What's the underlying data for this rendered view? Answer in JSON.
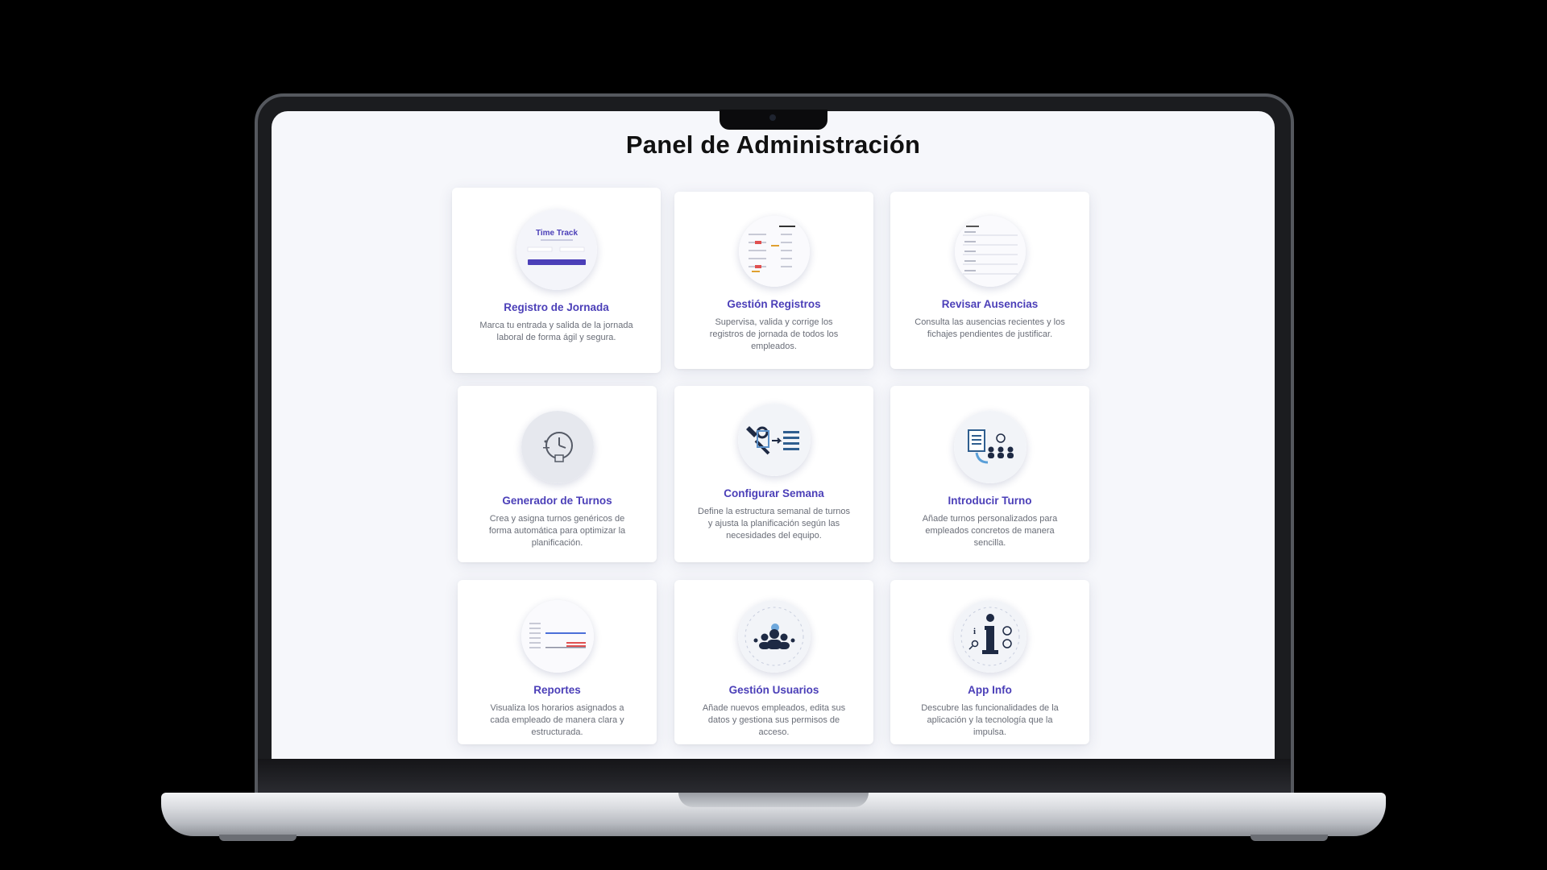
{
  "page": {
    "title": "Panel de Administración"
  },
  "colors": {
    "accent": "#4b3fb8",
    "background": "#f6f7fb",
    "card": "#ffffff",
    "description": "#6a6e78"
  },
  "cards": [
    {
      "title": "Registro de Jornada",
      "description": "Marca tu entrada y salida de la jornada laboral de forma ágil y segura.",
      "icon": "time-track-login-thumbnail",
      "thumb_title": "Time Track"
    },
    {
      "title": "Gestión Registros",
      "description": "Supervisa, valida y corrige los registros de jornada de todos los empleados.",
      "icon": "records-list-thumbnail"
    },
    {
      "title": "Revisar Ausencias",
      "description": "Consulta las ausencias recientes y los fichajes pendientes de justificar.",
      "icon": "absences-list-thumbnail"
    },
    {
      "title": "Generador de Turnos",
      "description": "Crea y asigna turnos genéricos de forma automática para optimizar la planificación.",
      "icon": "clock-calendar-icon"
    },
    {
      "title": "Configurar Semana",
      "description": "Define la estructura semanal de turnos y ajusta la planificación según las necesidades del equipo.",
      "icon": "tools-checklist-icon"
    },
    {
      "title": "Introducir Turno",
      "description": "Añade turnos personalizados para empleados concretos de manera sencilla.",
      "icon": "document-team-icon"
    },
    {
      "title": "Reportes",
      "description": "Visualiza los horarios asignados a cada empleado de manera clara y estructurada.",
      "icon": "report-grid-thumbnail"
    },
    {
      "title": "Gestión Usuarios",
      "description": "Añade nuevos empleados, edita sus datos y gestiona sus permisos de acceso.",
      "icon": "users-group-icon"
    },
    {
      "title": "App Info",
      "description": "Descubre las funcionalidades de la aplicación y la tecnología que la impulsa.",
      "icon": "info-icon"
    }
  ]
}
